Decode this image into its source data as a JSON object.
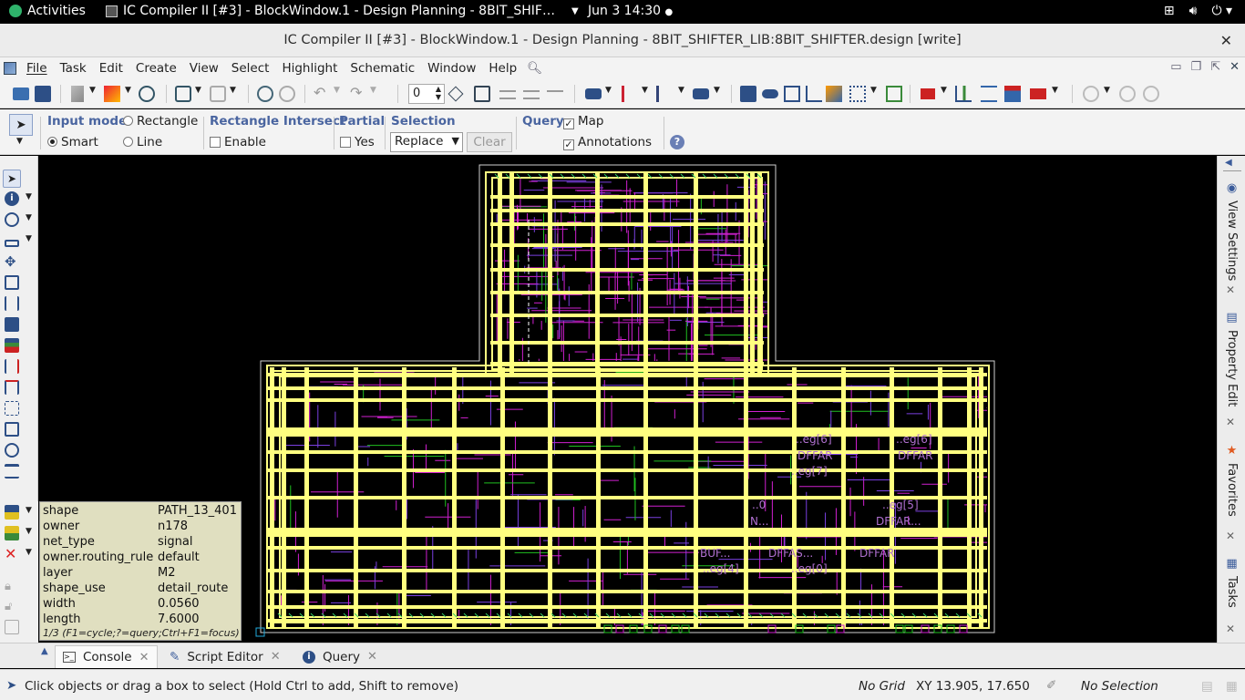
{
  "topbar": {
    "activities": "Activities",
    "app_title": "IC Compiler II [#3] - BlockWindow.1 - Design Planning - 8BIT_SHIF…",
    "datetime": "Jun 3  14:30"
  },
  "window": {
    "title": "IC Compiler II [#3] - BlockWindow.1 - Design Planning - 8BIT_SHIFTER_LIB:8BIT_SHIFTER.design [write]"
  },
  "menu": [
    "File",
    "Task",
    "Edit",
    "Create",
    "View",
    "Select",
    "Highlight",
    "Schematic",
    "Window",
    "Help"
  ],
  "toolbar": {
    "layer_spin_value": "0"
  },
  "options": {
    "input_mode_label": "Input mode",
    "rectangle": "Rectangle",
    "smart": "Smart",
    "line": "Line",
    "rect_intersect_label": "Rectangle Intersect",
    "enable": "Enable",
    "partial_label": "Partial",
    "yes": "Yes",
    "selection_label": "Selection",
    "selection_value": "Replace",
    "clear": "Clear",
    "query_label": "Query",
    "map": "Map",
    "annotations": "Annotations"
  },
  "query_popup": {
    "rows": [
      {
        "key": "shape",
        "value": "PATH_13_401"
      },
      {
        "key": "owner",
        "value": "n178"
      },
      {
        "key": "net_type",
        "value": "signal"
      },
      {
        "key": "owner.routing_rule",
        "value": "default"
      },
      {
        "key": "layer",
        "value": "M2"
      },
      {
        "key": "shape_use",
        "value": "detail_route"
      },
      {
        "key": "width",
        "value": "0.0560"
      },
      {
        "key": "length",
        "value": "7.6000"
      }
    ],
    "hint": "1/3 (F1=cycle;?=query;Ctrl+F1=focus)"
  },
  "canvas_labels": [
    "..eg[6]",
    "..eg[6]",
    "DFFAR",
    "DFFAR",
    "..eg[7]",
    "..0",
    "..eg[5]",
    "N...",
    "DFFAR...",
    "BUF...",
    "DFFAS...",
    "DFFAR",
    "..eg[4]",
    "..eg[0]"
  ],
  "right_dock": {
    "tabs": [
      "View Settings",
      "Property Edit",
      "Favorites",
      "Tasks"
    ]
  },
  "bottom_tabs": [
    "Console",
    "Script Editor",
    "Query"
  ],
  "status": {
    "message": "Click objects or drag a box to select (Hold Ctrl to add, Shift to remove)",
    "grid": "No Grid",
    "xy": "XY 13.905, 17.650",
    "selection": "No Selection"
  },
  "colors": {
    "power_rail": "#ffff80",
    "signal_route": "#d020d0",
    "signal_route_2": "#7a40e0",
    "green_route": "#20c020",
    "boundary": "#cfcfcf",
    "label_text": "#b070d0"
  }
}
